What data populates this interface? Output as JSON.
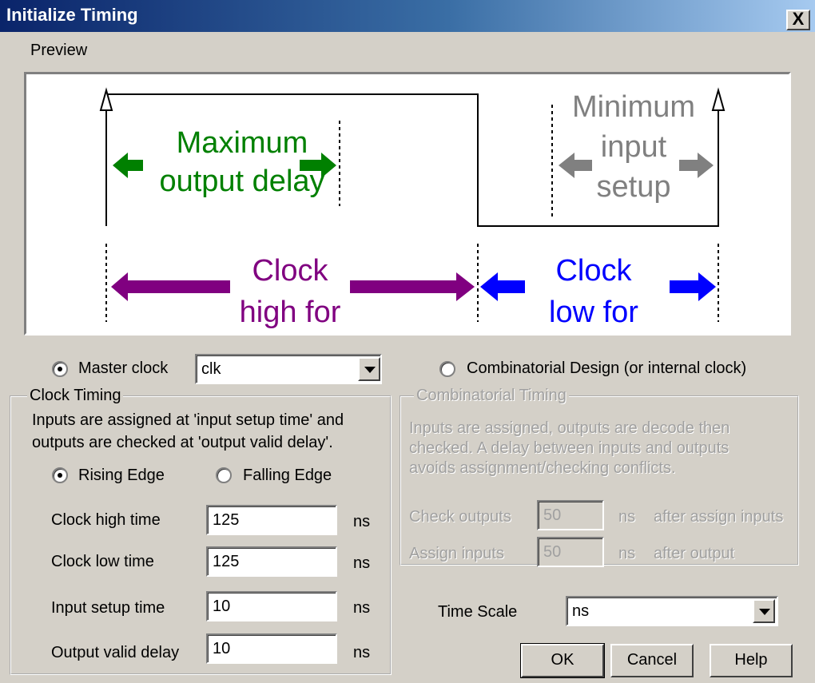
{
  "window": {
    "title": "Initialize Timing",
    "close_label": "X"
  },
  "preview": {
    "label": "Preview",
    "max_output_delay": [
      "Maximum",
      "output delay"
    ],
    "min_input_setup": [
      "Minimum",
      "input",
      "setup"
    ],
    "clock_high_for": [
      "Clock",
      "high for"
    ],
    "clock_low_for": [
      "Clock",
      "low for"
    ],
    "colors": {
      "green": "#008000",
      "gray": "#808080",
      "purple": "#800080",
      "blue": "#0000ff"
    }
  },
  "clock_source": {
    "master_clock_label": "Master clock",
    "master_clock_selected": true,
    "master_clock_value": "clk",
    "combinatorial_label": "Combinatorial Design (or internal clock)",
    "combinatorial_selected": false
  },
  "clock_timing": {
    "legend": "Clock Timing",
    "description": [
      "Inputs are assigned at 'input setup time' and",
      "outputs are checked at 'output valid delay'."
    ],
    "rising_edge_label": "Rising Edge",
    "falling_edge_label": "Falling Edge",
    "edge_selected": "Rising Edge",
    "rows": [
      {
        "label": "Clock high time",
        "value": "125",
        "unit": "ns"
      },
      {
        "label": "Clock low time",
        "value": "125",
        "unit": "ns"
      },
      {
        "label": "Input setup time",
        "value": "10",
        "unit": "ns"
      },
      {
        "label": "Output valid delay",
        "value": "10",
        "unit": "ns"
      }
    ]
  },
  "combinatorial_timing": {
    "legend": "Combinatorial Timing",
    "description": [
      "Inputs are assigned, outputs are decode then",
      "checked.  A delay between inputs and outputs",
      "avoids assignment/checking conflicts."
    ],
    "check_outputs": {
      "label": "Check outputs",
      "value": "50",
      "unit": "ns",
      "suffix": "after assign inputs"
    },
    "assign_inputs": {
      "label": "Assign inputs",
      "value": "50",
      "unit": "ns",
      "suffix": "after output"
    }
  },
  "time_scale": {
    "label": "Time Scale",
    "value": "ns"
  },
  "buttons": {
    "ok": "OK",
    "cancel": "Cancel",
    "help": "Help"
  }
}
